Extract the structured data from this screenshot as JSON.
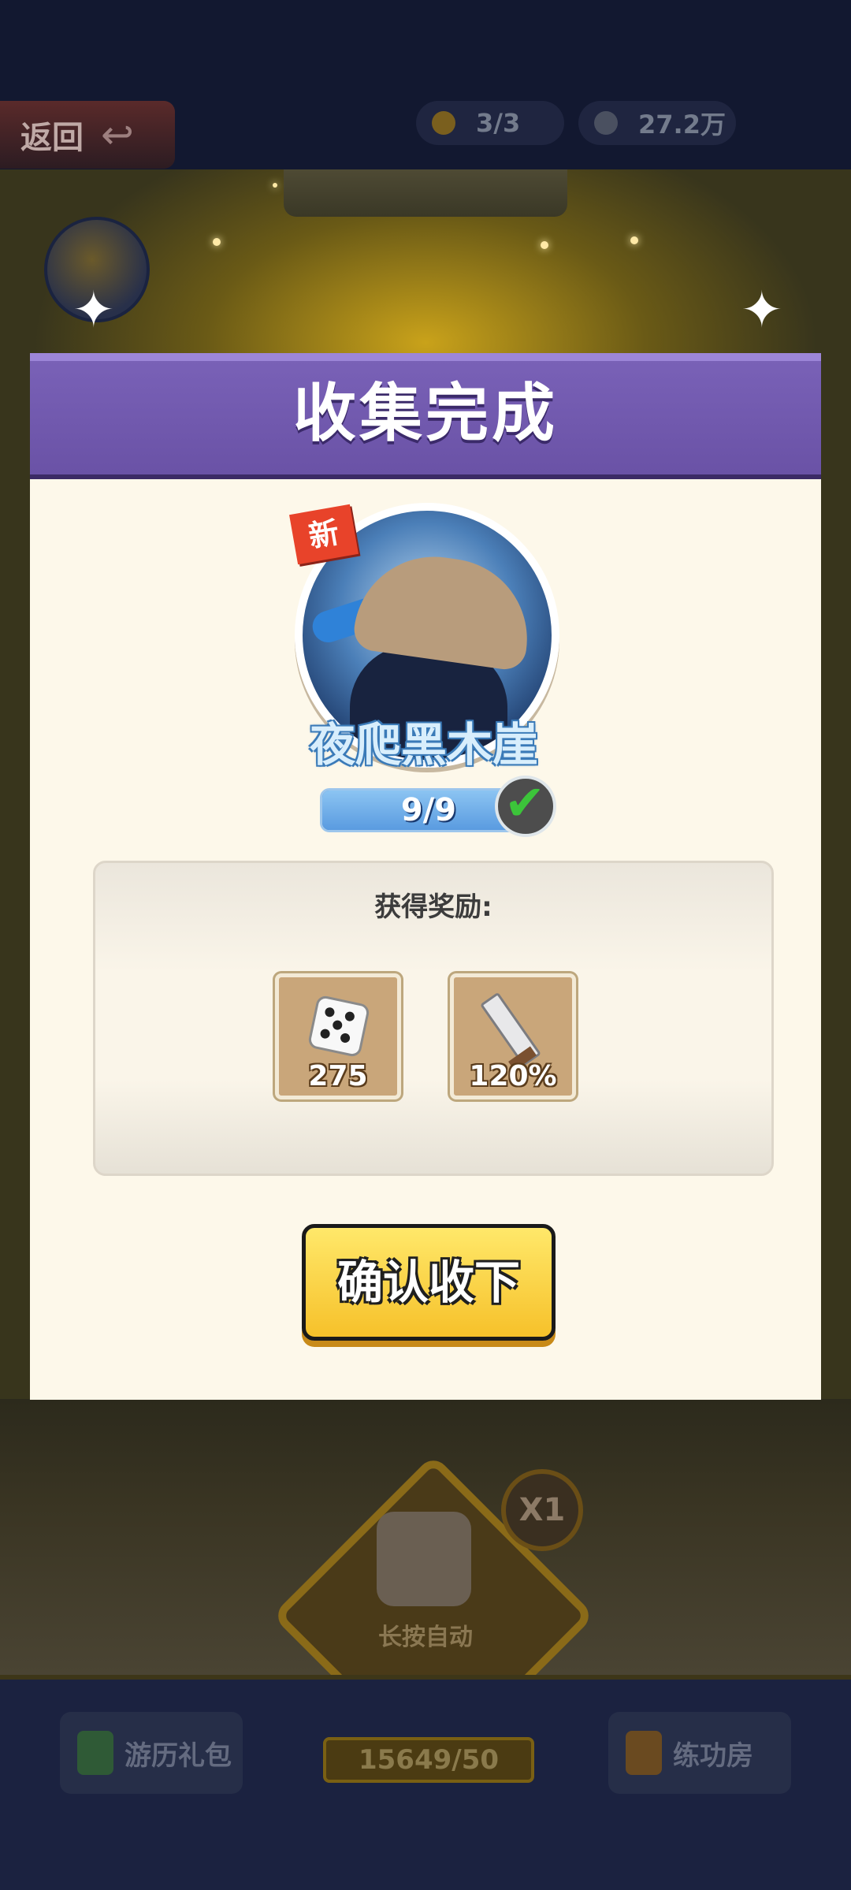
{
  "topbar": {
    "back_label": "返回",
    "tickets": "3/3",
    "coins": "27.2万"
  },
  "modal": {
    "title": "收集完成",
    "new_badge": "新",
    "hero_name": "夜爬黑木崖",
    "progress_text": "9/9",
    "progress_fraction": 1.0,
    "reward_title": "获得奖励:",
    "rewards": [
      {
        "icon": "dice-icon",
        "count": "275"
      },
      {
        "icon": "sword-icon",
        "count": "120%"
      }
    ],
    "confirm_label": "确认收下"
  },
  "game": {
    "multiplier": "X1",
    "dice_hold_label": "长按自动",
    "travel_gift_label": "游历礼包",
    "training_room_label": "练功房",
    "energy_counter": "15649/50"
  },
  "colors": {
    "header_purple": "#6a52a6",
    "confirm_yellow": "#f6c12a",
    "modal_bg": "#fdf8ea",
    "progress_blue": "#2d6fc0"
  }
}
